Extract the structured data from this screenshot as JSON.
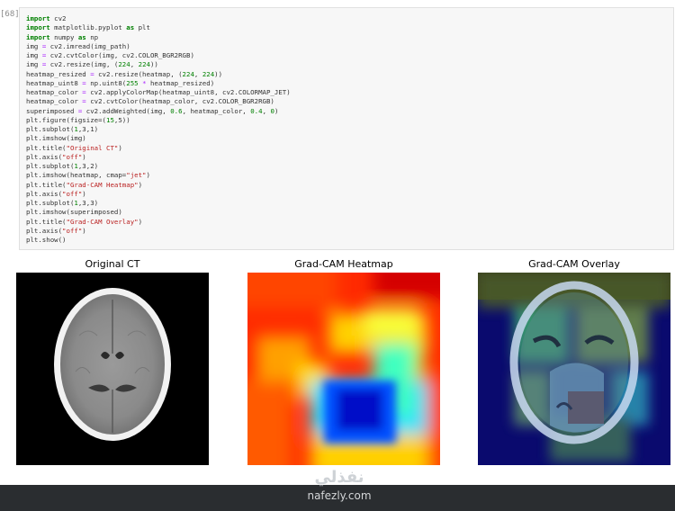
{
  "cell": {
    "prompt": "[68]:",
    "code_lines": [
      "import cv2",
      "import matplotlib.pyplot as plt",
      "import numpy as np",
      "img = cv2.imread(img_path)",
      "img = cv2.cvtColor(img, cv2.COLOR_BGR2RGB)",
      "img = cv2.resize(img, (224, 224))",
      "heatmap_resized = cv2.resize(heatmap, (224, 224))",
      "heatmap_uint8 = np.uint8(255 * heatmap_resized)",
      "heatmap_color = cv2.applyColorMap(heatmap_uint8, cv2.COLORMAP_JET)",
      "heatmap_color = cv2.cvtColor(heatmap_color, cv2.COLOR_BGR2RGB)",
      "superimposed = cv2.addWeighted(img, 0.6, heatmap_color, 0.4, 0)",
      "plt.figure(figsize=(15,5))",
      "plt.subplot(1,3,1)",
      "plt.imshow(img)",
      "plt.title(\"Original CT\")",
      "plt.axis(\"off\")",
      "plt.subplot(1,3,2)",
      "plt.imshow(heatmap, cmap=\"jet\")",
      "plt.title(\"Grad-CAM Heatmap\")",
      "plt.axis(\"off\")",
      "plt.subplot(1,3,3)",
      "plt.imshow(superimposed)",
      "plt.title(\"Grad-CAM Overlay\")",
      "plt.axis(\"off\")",
      "plt.show()"
    ]
  },
  "output": {
    "titles": [
      "Original CT",
      "Grad-CAM Heatmap",
      "Grad-CAM Overlay"
    ]
  },
  "watermark": {
    "arabic": "نفذلي",
    "latin": "nafezly.com"
  }
}
